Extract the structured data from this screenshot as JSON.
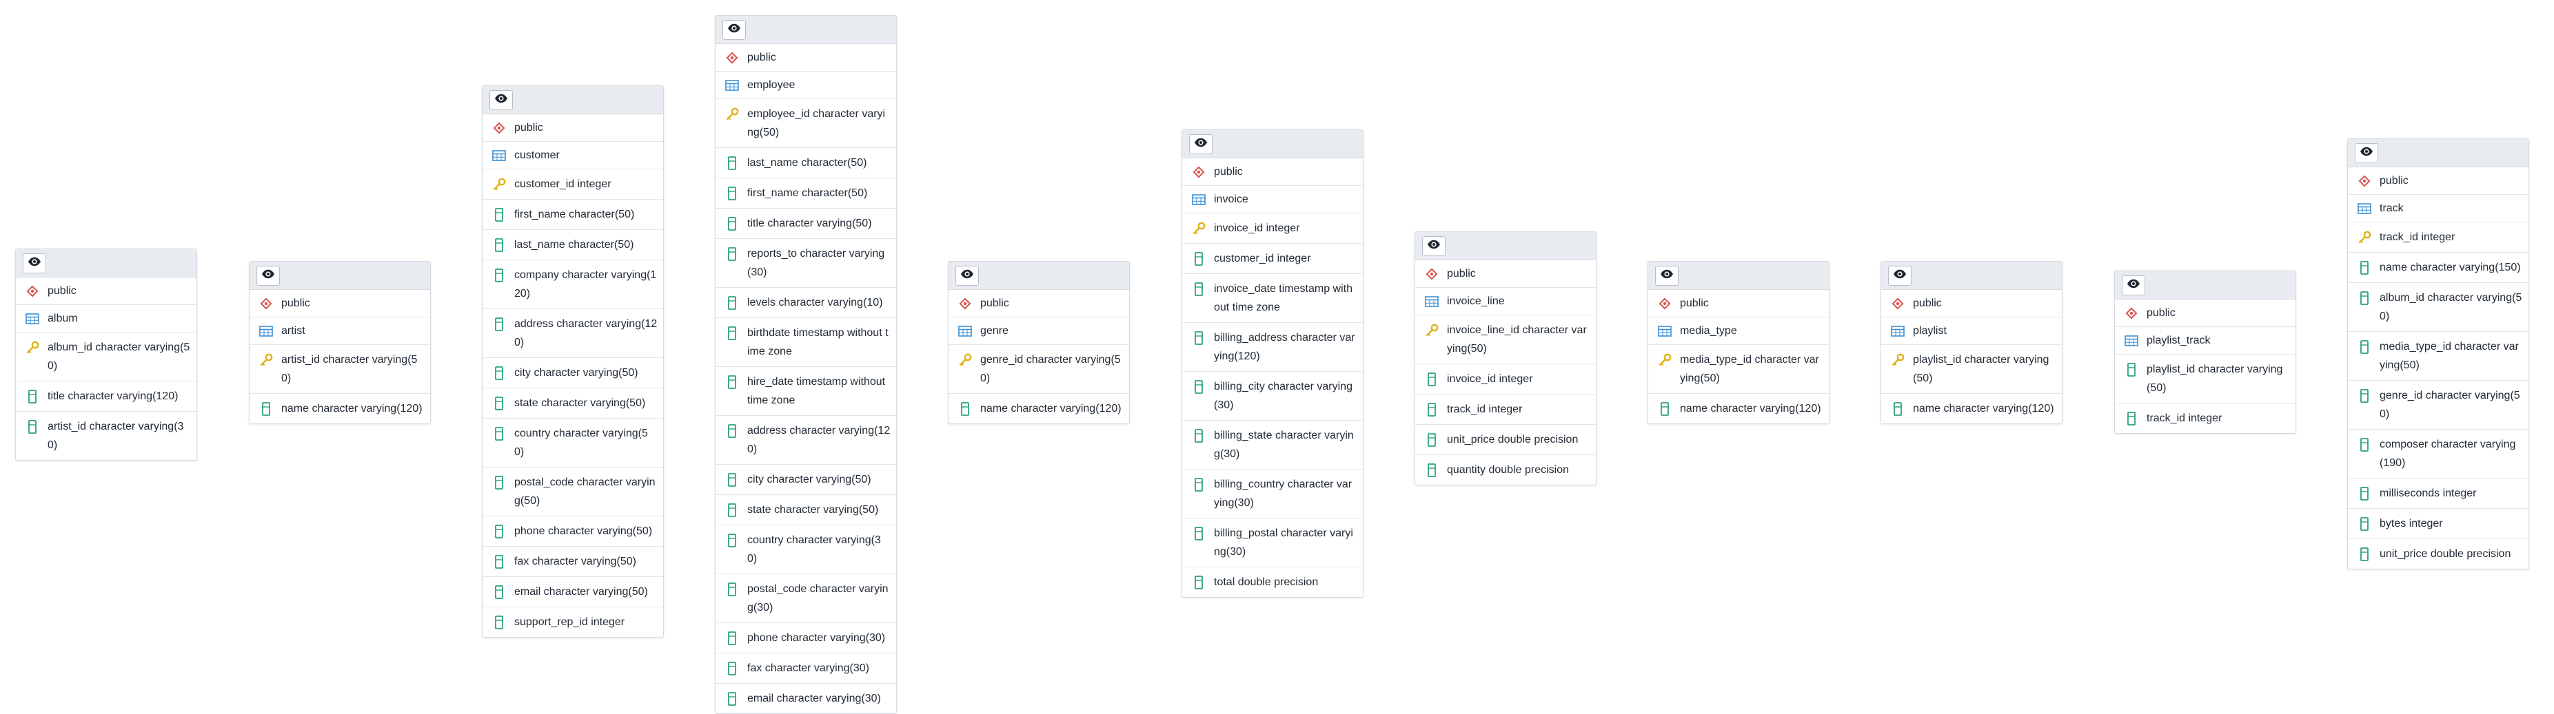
{
  "colors": {
    "schema_icon": "#d9534f",
    "table_icon": "#3b8fd6",
    "key_icon": "#e0b21b",
    "column_icon": "#2aa378",
    "header_bg": "#e8ebef"
  },
  "icons": {
    "toggle": "eye-icon",
    "schema": "schema-icon",
    "table": "table-icon",
    "primary_key": "key-icon",
    "column": "column-icon"
  },
  "tables": [
    {
      "schema": "public",
      "name": "album",
      "columns": [
        {
          "text": "album_id character varying(50)",
          "pk": true
        },
        {
          "text": "title character varying(120)",
          "pk": false
        },
        {
          "text": "artist_id character varying(30)",
          "pk": false
        }
      ]
    },
    {
      "schema": "public",
      "name": "artist",
      "columns": [
        {
          "text": "artist_id character varying(50)",
          "pk": true
        },
        {
          "text": "name character varying(120)",
          "pk": false
        }
      ]
    },
    {
      "schema": "public",
      "name": "customer",
      "columns": [
        {
          "text": "customer_id integer",
          "pk": true
        },
        {
          "text": "first_name character(50)",
          "pk": false
        },
        {
          "text": "last_name character(50)",
          "pk": false
        },
        {
          "text": "company character varying(120)",
          "pk": false
        },
        {
          "text": "address character varying(120)",
          "pk": false
        },
        {
          "text": "city character varying(50)",
          "pk": false
        },
        {
          "text": "state character varying(50)",
          "pk": false
        },
        {
          "text": "country character varying(50)",
          "pk": false
        },
        {
          "text": "postal_code character varying(50)",
          "pk": false
        },
        {
          "text": "phone character varying(50)",
          "pk": false
        },
        {
          "text": "fax character varying(50)",
          "pk": false
        },
        {
          "text": "email character varying(50)",
          "pk": false
        },
        {
          "text": "support_rep_id integer",
          "pk": false
        }
      ]
    },
    {
      "schema": "public",
      "name": "employee",
      "columns": [
        {
          "text": "employee_id character varying(50)",
          "pk": true
        },
        {
          "text": "last_name character(50)",
          "pk": false
        },
        {
          "text": "first_name character(50)",
          "pk": false
        },
        {
          "text": "title character varying(50)",
          "pk": false
        },
        {
          "text": "reports_to character varying(30)",
          "pk": false
        },
        {
          "text": "levels character varying(10)",
          "pk": false
        },
        {
          "text": "birthdate timestamp without time zone",
          "pk": false
        },
        {
          "text": "hire_date timestamp without time zone",
          "pk": false
        },
        {
          "text": "address character varying(120)",
          "pk": false
        },
        {
          "text": "city character varying(50)",
          "pk": false
        },
        {
          "text": "state character varying(50)",
          "pk": false
        },
        {
          "text": "country character varying(30)",
          "pk": false
        },
        {
          "text": "postal_code character varying(30)",
          "pk": false
        },
        {
          "text": "phone character varying(30)",
          "pk": false
        },
        {
          "text": "fax character varying(30)",
          "pk": false
        },
        {
          "text": "email character varying(30)",
          "pk": false
        }
      ]
    },
    {
      "schema": "public",
      "name": "genre",
      "columns": [
        {
          "text": "genre_id character varying(50)",
          "pk": true
        },
        {
          "text": "name character varying(120)",
          "pk": false
        }
      ]
    },
    {
      "schema": "public",
      "name": "invoice",
      "columns": [
        {
          "text": "invoice_id integer",
          "pk": true
        },
        {
          "text": "customer_id integer",
          "pk": false
        },
        {
          "text": "invoice_date timestamp without time zone",
          "pk": false
        },
        {
          "text": "billing_address character varying(120)",
          "pk": false
        },
        {
          "text": "billing_city character varying(30)",
          "pk": false
        },
        {
          "text": "billing_state character varying(30)",
          "pk": false
        },
        {
          "text": "billing_country character varying(30)",
          "pk": false
        },
        {
          "text": "billing_postal character varying(30)",
          "pk": false
        },
        {
          "text": "total double precision",
          "pk": false
        }
      ]
    },
    {
      "schema": "public",
      "name": "invoice_line",
      "columns": [
        {
          "text": "invoice_line_id character varying(50)",
          "pk": true
        },
        {
          "text": "invoice_id integer",
          "pk": false
        },
        {
          "text": "track_id integer",
          "pk": false
        },
        {
          "text": "unit_price double precision",
          "pk": false
        },
        {
          "text": "quantity double precision",
          "pk": false
        }
      ]
    },
    {
      "schema": "public",
      "name": "media_type",
      "columns": [
        {
          "text": "media_type_id character varying(50)",
          "pk": true
        },
        {
          "text": "name character varying(120)",
          "pk": false
        }
      ]
    },
    {
      "schema": "public",
      "name": "playlist",
      "columns": [
        {
          "text": "playlist_id character varying(50)",
          "pk": true
        },
        {
          "text": "name character varying(120)",
          "pk": false
        }
      ]
    },
    {
      "schema": "public",
      "name": "playlist_track",
      "columns": [
        {
          "text": "playlist_id character varying(50)",
          "pk": false
        },
        {
          "text": "track_id integer",
          "pk": false
        }
      ]
    },
    {
      "schema": "public",
      "name": "track",
      "columns": [
        {
          "text": "track_id integer",
          "pk": true
        },
        {
          "text": "name character varying(150)",
          "pk": false
        },
        {
          "text": "album_id character varying(50)",
          "pk": false
        },
        {
          "text": "media_type_id character varying(50)",
          "pk": false
        },
        {
          "text": "genre_id character varying(50)",
          "pk": false
        },
        {
          "text": "composer character varying(190)",
          "pk": false
        },
        {
          "text": "milliseconds integer",
          "pk": false
        },
        {
          "text": "bytes integer",
          "pk": false
        },
        {
          "text": "unit_price double precision",
          "pk": false
        }
      ]
    }
  ]
}
